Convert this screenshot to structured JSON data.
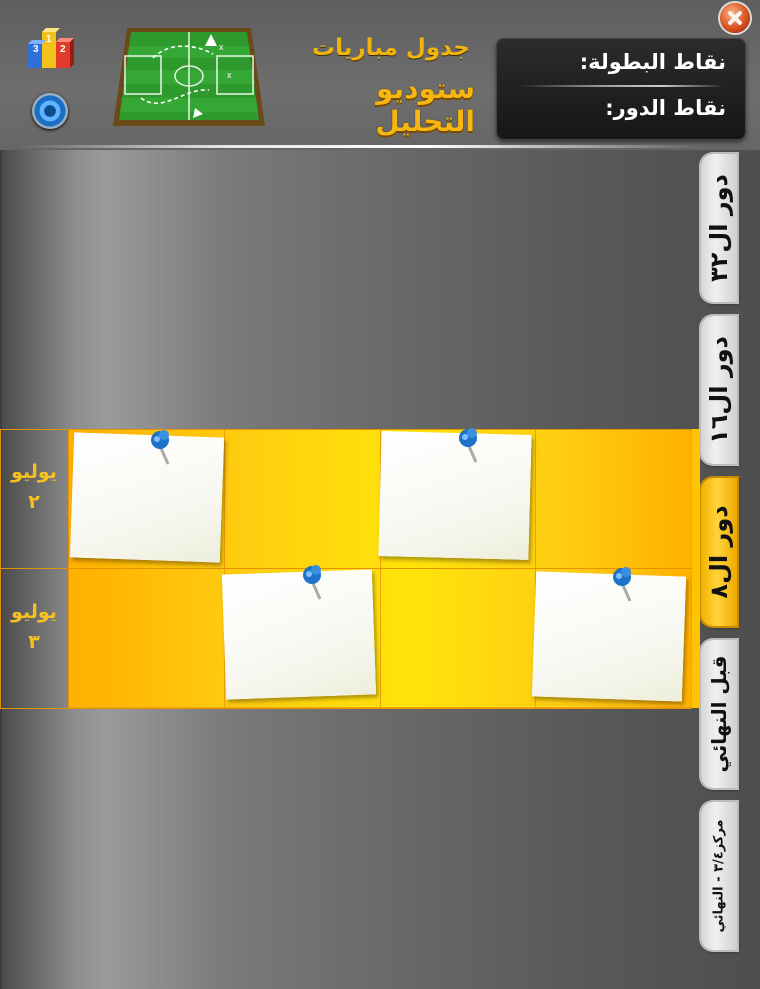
{
  "header": {
    "title_top": "جدول مباريات",
    "title_main": "ستوديو التحليل"
  },
  "points_panel": {
    "championship_points": "نقاط البطولة:",
    "round_points": "نقاط الدور:"
  },
  "tabs": [
    {
      "label": "دور ال٣٢",
      "active": false
    },
    {
      "label": "دور ال١٦",
      "active": false
    },
    {
      "label": "دور ال٨",
      "active": true
    },
    {
      "label": "قبل النهائي",
      "active": false
    },
    {
      "label": "مركز٣/٤ - النهائي",
      "active": false
    }
  ],
  "schedule": {
    "rows": [
      {
        "month": "يوليو",
        "day": "٢"
      },
      {
        "month": "يوليو",
        "day": "٣"
      }
    ]
  },
  "colors": {
    "accent": "#f7b712",
    "grid_yellow": "#ffd010",
    "panel_bg": "#1e1e1e"
  },
  "icons": [
    "close-icon",
    "podium-icon",
    "speaker-icon",
    "football-field-logo",
    "pushpin-icon"
  ]
}
